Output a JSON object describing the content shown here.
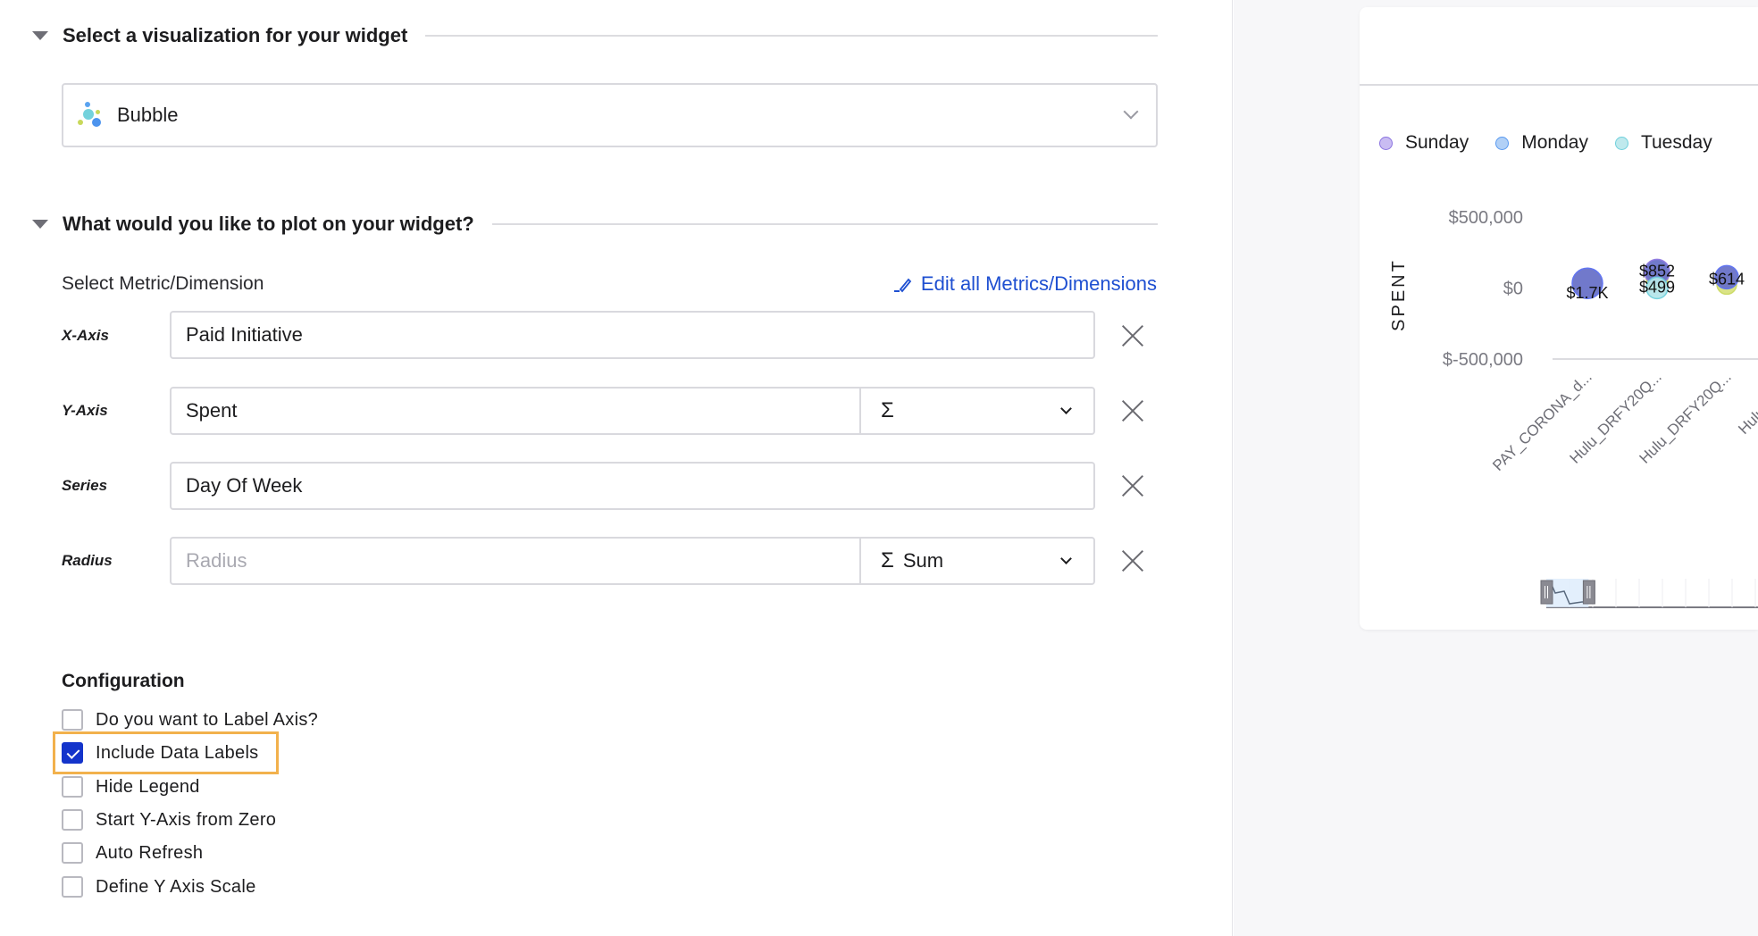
{
  "sections": {
    "visualization": {
      "title": "Select a visualization for your widget",
      "selected": "Bubble"
    },
    "plot": {
      "title": "What would you like to plot on your widget?"
    }
  },
  "metric": {
    "label": "Select Metric/Dimension",
    "edit_link": "Edit all Metrics/Dimensions",
    "rows": [
      {
        "label": "X-Axis",
        "value": "Paid Initiative",
        "placeholder": "",
        "aggregation": null
      },
      {
        "label": "Y-Axis",
        "value": "Spent",
        "placeholder": "",
        "aggregation": {
          "symbol": "Σ",
          "text": ""
        }
      },
      {
        "label": "Series",
        "value": "Day Of Week",
        "placeholder": "",
        "aggregation": null
      },
      {
        "label": "Radius",
        "value": "",
        "placeholder": "Radius",
        "aggregation": {
          "symbol": "Σ",
          "text": "Sum"
        }
      }
    ]
  },
  "configuration": {
    "title": "Configuration",
    "options": [
      {
        "label": "Do you want to Label Axis?",
        "checked": false
      },
      {
        "label": "Include Data Labels",
        "checked": true,
        "highlighted": true
      },
      {
        "label": "Hide Legend",
        "checked": false
      },
      {
        "label": "Start Y-Axis from Zero",
        "checked": false
      },
      {
        "label": "Auto Refresh",
        "checked": false
      },
      {
        "label": "Define Y Axis Scale",
        "checked": false
      }
    ]
  },
  "colors": {
    "accent": "#1e4fd1",
    "checkbox_checked": "#1434cb",
    "highlight": "#f2b14c"
  },
  "chart_data": {
    "type": "scatter",
    "subtype": "bubble",
    "title": "",
    "xlabel": "",
    "ylabel": "SPENT",
    "ylim": [
      -500000,
      500000
    ],
    "yticks": [
      "$500,000",
      "$0",
      "$-500,000"
    ],
    "legend_position": "top",
    "legend": [
      {
        "name": "Sunday",
        "color": "#b9a8ee",
        "stroke": "#8b74e0"
      },
      {
        "name": "Monday",
        "color": "#a6c8f5",
        "stroke": "#5a9af0"
      },
      {
        "name": "Tuesday",
        "color": "#b6e6ea",
        "stroke": "#6fd0dc"
      }
    ],
    "categories": [
      "PAY_CORONA_d...",
      "Hulu_DRFY20Q...",
      "Hulu_DRFY20Q...",
      "Hulu_DRFY"
    ],
    "points": [
      {
        "category": 0,
        "value": 1700,
        "label": "$1.7K"
      },
      {
        "category": 1,
        "value": 852,
        "label": "$852"
      },
      {
        "category": 1,
        "value": 499,
        "label": "$499"
      },
      {
        "category": 2,
        "value": 614,
        "label": "$614"
      }
    ],
    "data_zoom": {
      "start": 0,
      "end": 0.2
    }
  }
}
